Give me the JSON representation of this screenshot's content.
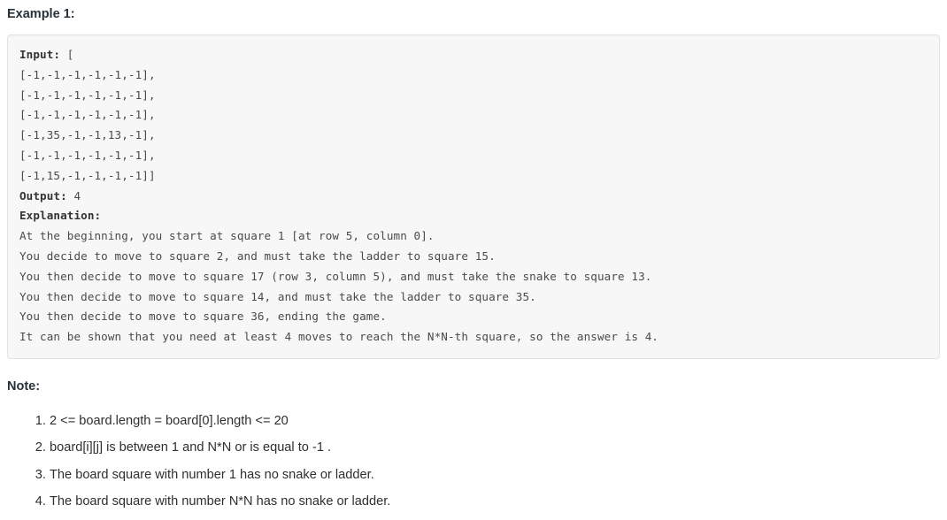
{
  "example": {
    "heading": "Example 1:",
    "input_label": "Input:",
    "input_value": " [",
    "board_rows": [
      "[-1,-1,-1,-1,-1,-1],",
      "[-1,-1,-1,-1,-1,-1],",
      "[-1,-1,-1,-1,-1,-1],",
      "[-1,35,-1,-1,13,-1],",
      "[-1,-1,-1,-1,-1,-1],",
      "[-1,15,-1,-1,-1,-1]]"
    ],
    "output_label": "Output:",
    "output_value": " 4",
    "explanation_label": "Explanation:",
    "explanation_lines": [
      "At the beginning, you start at square 1 [at row 5, column 0].",
      "You decide to move to square 2, and must take the ladder to square 15.",
      "You then decide to move to square 17 (row 3, column 5), and must take the snake to square 13.",
      "You then decide to move to square 14, and must take the ladder to square 35.",
      "You then decide to move to square 36, ending the game.",
      "It can be shown that you need at least 4 moves to reach the N*N-th square, so the answer is 4."
    ]
  },
  "note": {
    "heading": "Note:",
    "items": [
      {
        "parts": [
          {
            "type": "code",
            "text": "2 <= board.length = board[0].length <= 20"
          }
        ]
      },
      {
        "parts": [
          {
            "type": "code",
            "text": "board[i][j]"
          },
          {
            "type": "text",
            "text": " is between "
          },
          {
            "type": "code",
            "text": "1"
          },
          {
            "type": "text",
            "text": " and "
          },
          {
            "type": "code",
            "text": "N*N"
          },
          {
            "type": "text",
            "text": " or is equal to "
          },
          {
            "type": "code",
            "text": "-1"
          },
          {
            "type": "text",
            "text": " ."
          }
        ]
      },
      {
        "parts": [
          {
            "type": "text",
            "text": "The board square with number "
          },
          {
            "type": "code",
            "text": "1"
          },
          {
            "type": "text",
            "text": " has no snake or ladder."
          }
        ]
      },
      {
        "parts": [
          {
            "type": "text",
            "text": "The board square with number "
          },
          {
            "type": "code",
            "text": "N*N"
          },
          {
            "type": "text",
            "text": " has no snake or ladder."
          }
        ]
      }
    ]
  },
  "colors": {
    "code_block_background": "#f7f7f7",
    "code_block_border": "#e3e3e3",
    "inline_code_text": "#c7254e",
    "inline_code_background": "#f9f2f4",
    "body_text": "#333333"
  }
}
